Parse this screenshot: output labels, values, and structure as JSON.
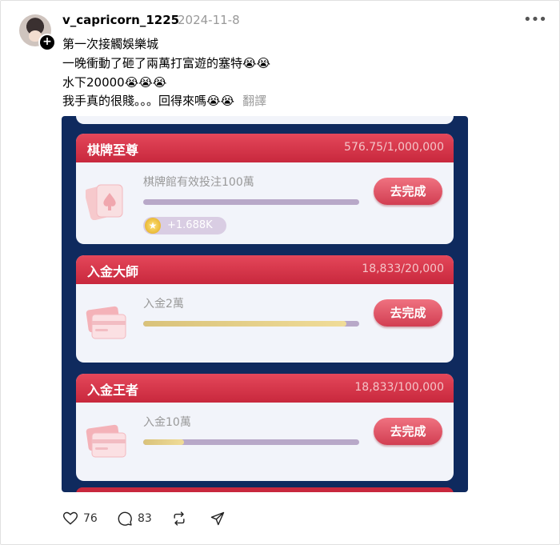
{
  "post": {
    "username": "v_capricorn_1225",
    "date": "2024-11-8",
    "lines": [
      "第一次接觸娛樂城",
      "一晚衝動了砸了兩萬打富遊的塞特😭😭",
      "水下20000😭😭😭",
      "我手真的很賤。。。回得來嗎😭😭"
    ],
    "translate_label": "翻譯"
  },
  "tasks": [
    {
      "title": "棋牌至尊",
      "progress": "576.75/1,000,000",
      "label": "棋牌館有效投注100萬",
      "fill": 0.0006,
      "button": "去完成",
      "reward": "+1.688K"
    },
    {
      "title": "入金大師",
      "progress": "18,833/20,000",
      "label": "入金2萬",
      "fill": 0.94,
      "button": "去完成"
    },
    {
      "title": "入金王者",
      "progress": "18,833/100,000",
      "label": "入金10萬",
      "fill": 0.19,
      "button": "去完成"
    }
  ],
  "actions": {
    "likes": "76",
    "comments": "83"
  },
  "icons": {
    "more": "more-icon",
    "like": "heart-icon",
    "comment": "comment-icon",
    "repost": "repost-icon",
    "share": "share-icon"
  }
}
